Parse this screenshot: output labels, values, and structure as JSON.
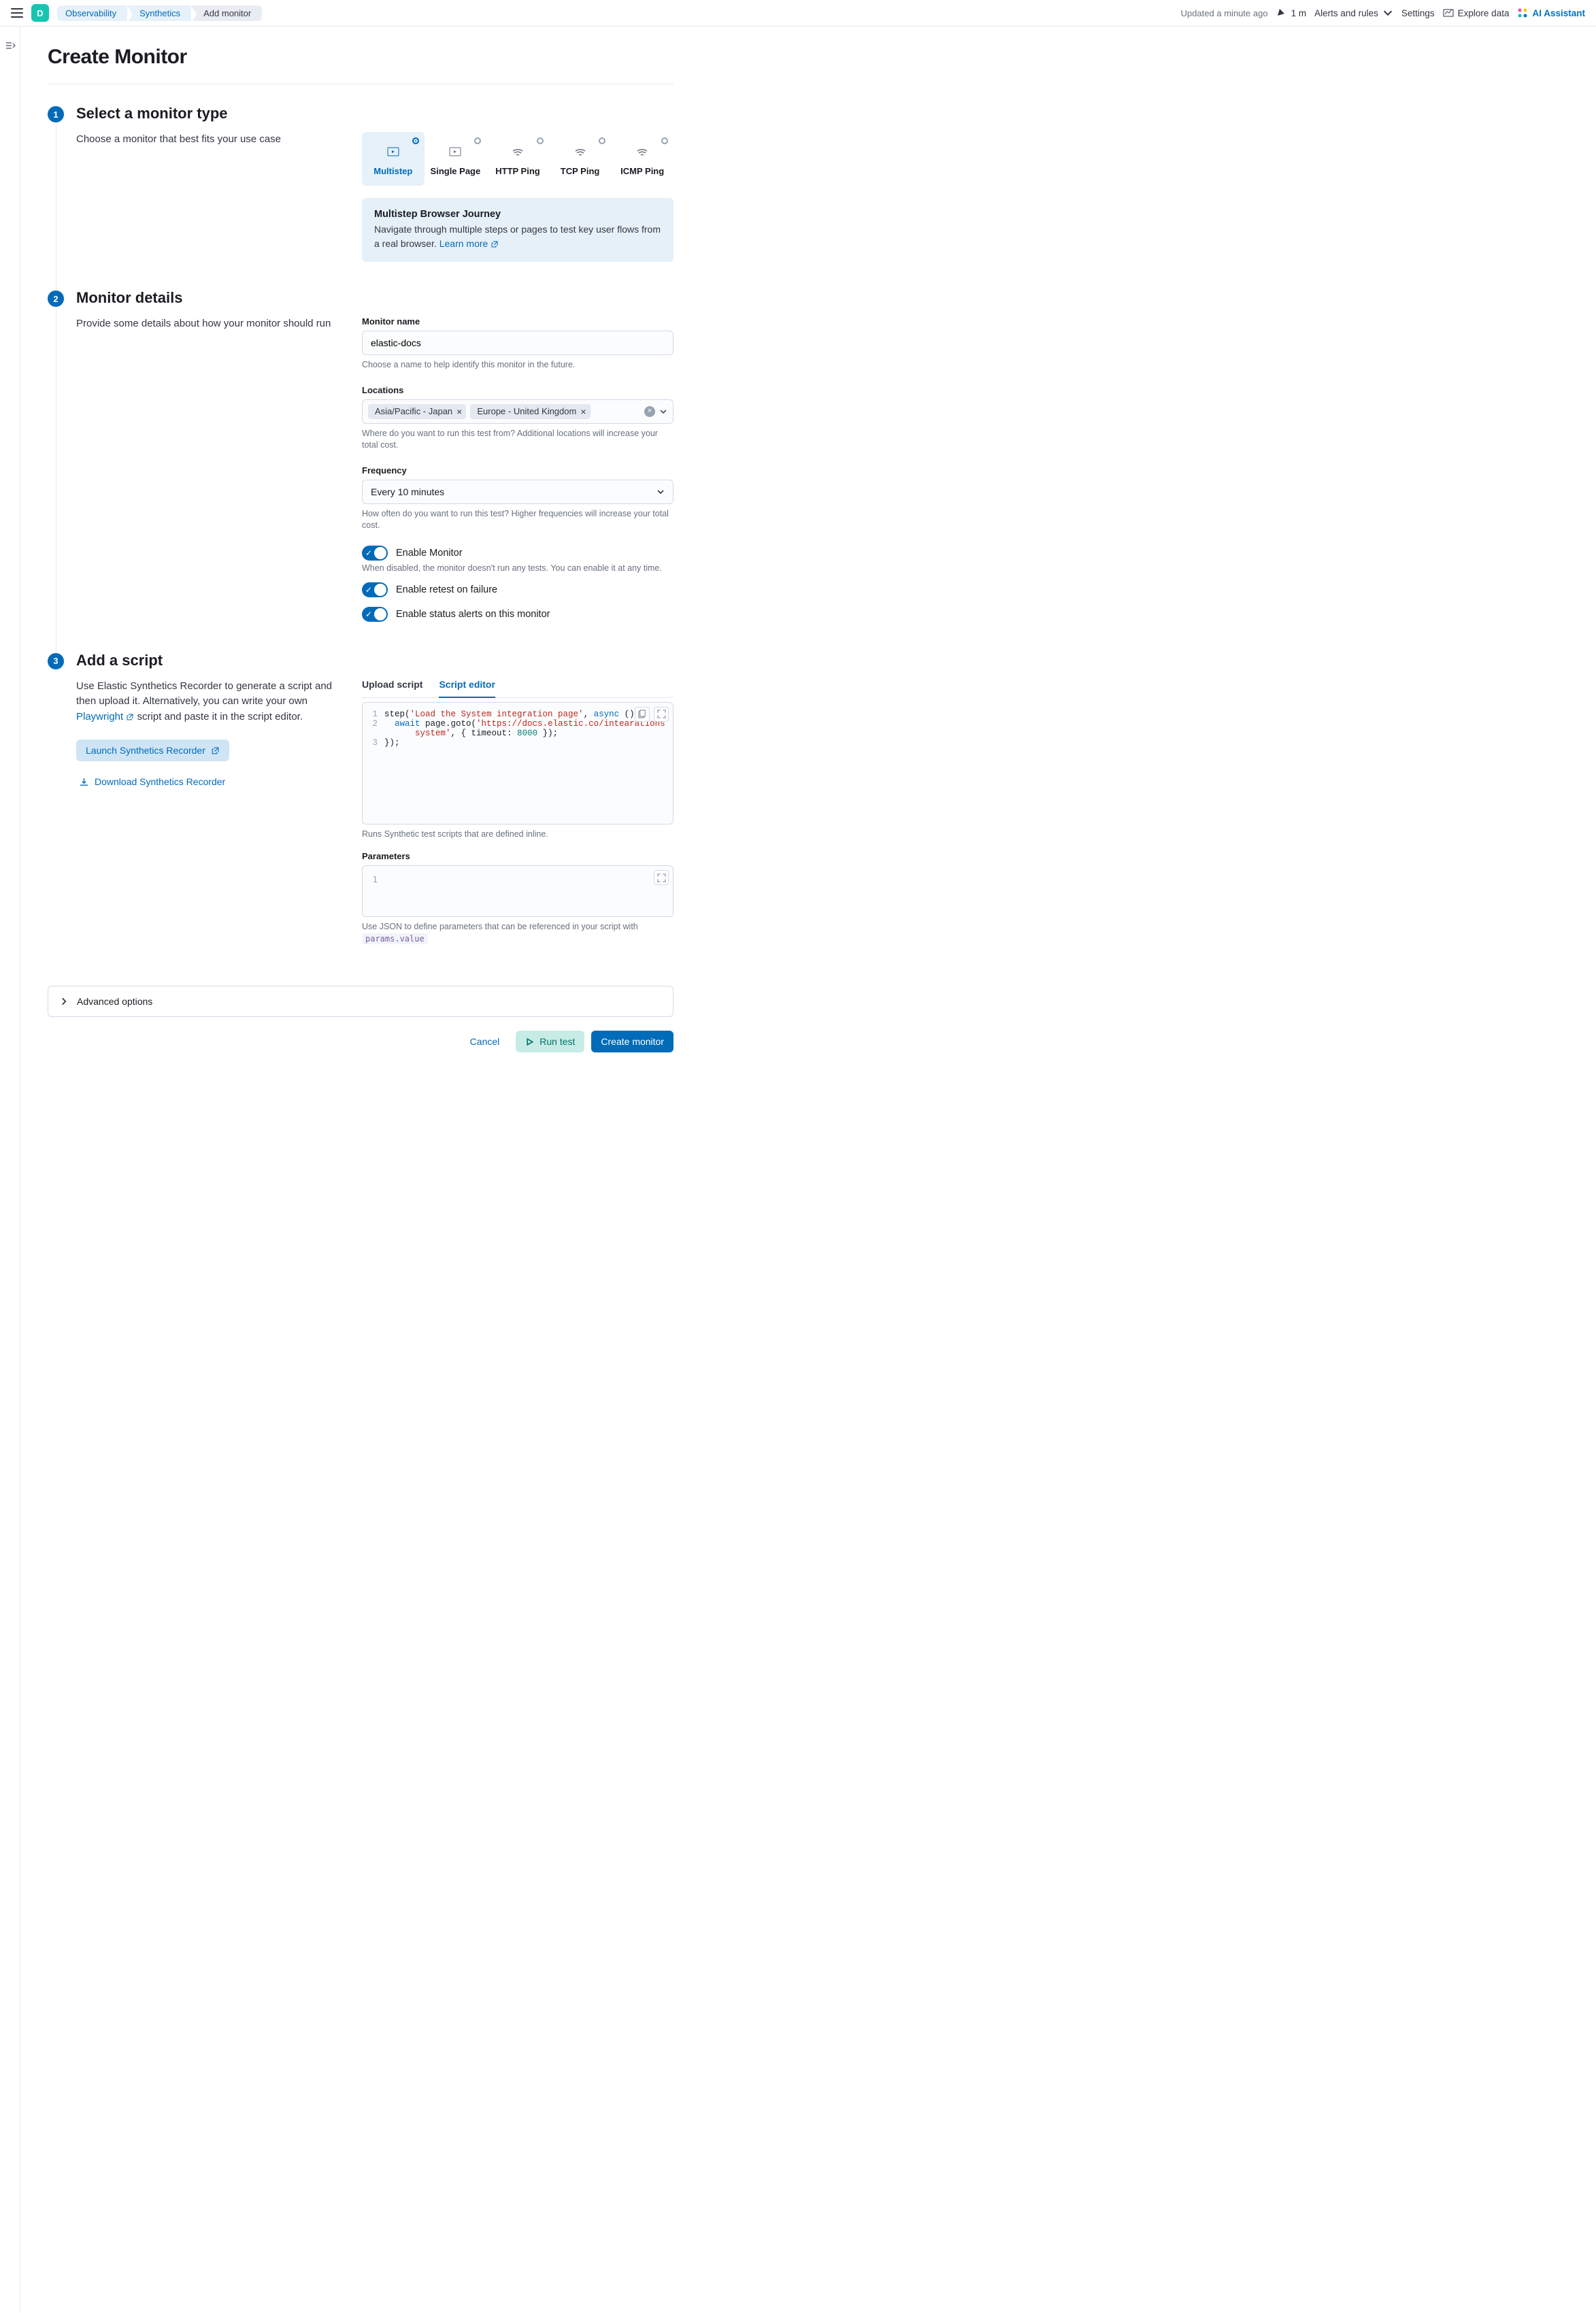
{
  "header": {
    "space_initial": "D",
    "breadcrumbs": [
      "Observability",
      "Synthetics",
      "Add monitor"
    ],
    "updated_text": "Updated a minute ago",
    "news_count": "1 m",
    "alerts_label": "Alerts and rules",
    "settings_label": "Settings",
    "explore_label": "Explore data",
    "ai_label": "AI Assistant"
  },
  "page_title": "Create Monitor",
  "step1": {
    "title": "Select a monitor type",
    "desc": "Choose a monitor that best fits your use case",
    "types": [
      "Multistep",
      "Single Page",
      "HTTP Ping",
      "TCP Ping",
      "ICMP Ping"
    ],
    "callout_title": "Multistep Browser Journey",
    "callout_body": "Navigate through multiple steps or pages to test key user flows from a real browser. ",
    "callout_link": "Learn more"
  },
  "step2": {
    "title": "Monitor details",
    "desc": "Provide some details about how your monitor should run",
    "name_label": "Monitor name",
    "name_value": "elastic-docs",
    "name_help": "Choose a name to help identify this monitor in the future.",
    "loc_label": "Locations",
    "loc_chips": [
      "Asia/Pacific - Japan",
      "Europe - United Kingdom"
    ],
    "loc_help": "Where do you want to run this test from? Additional locations will increase your total cost.",
    "freq_label": "Frequency",
    "freq_value": "Every 10 minutes",
    "freq_help": "How often do you want to run this test? Higher frequencies will increase your total cost.",
    "enable_label": "Enable Monitor",
    "enable_help": "When disabled, the monitor doesn't run any tests. You can enable it at any time.",
    "retest_label": "Enable retest on failure",
    "alerts_label": "Enable status alerts on this monitor"
  },
  "step3": {
    "title": "Add a script",
    "desc_1": "Use Elastic Synthetics Recorder to generate a script and then upload it. Alternatively, you can write your own ",
    "desc_link": "Playwright",
    "desc_2": " script and paste it in the script editor.",
    "launch_btn": "Launch Synthetics Recorder",
    "download_btn": "Download Synthetics Recorder",
    "tab_upload": "Upload script",
    "tab_editor": "Script editor",
    "code_lines": [
      {
        "n": "1",
        "html": "step(<span class='tok-str'>'Load the System integration page'</span>, <span class='tok-kw'>async</span> () =&gt; {"
      },
      {
        "n": "2",
        "html": "  <span class='tok-kw'>await</span> page.goto(<span class='tok-str'>'https://docs.elastic.co/intearations<br>      system'</span>, { timeout: <span class='tok-num'>8000</span> });"
      },
      {
        "n": "3",
        "html": "});"
      }
    ],
    "code_help": "Runs Synthetic test scripts that are defined inline.",
    "params_label": "Parameters",
    "params_line": "1",
    "params_help_1": "Use JSON to define parameters that can be referenced in your script with ",
    "params_code": "params.value"
  },
  "advanced_label": "Advanced options",
  "footer": {
    "cancel": "Cancel",
    "run": "Run test",
    "create": "Create monitor"
  }
}
